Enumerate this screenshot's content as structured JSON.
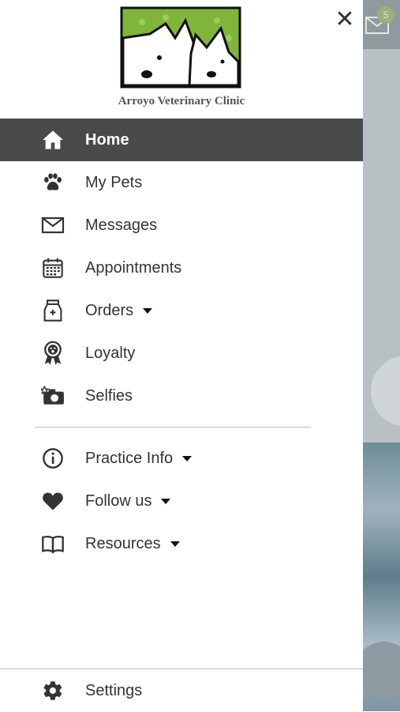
{
  "brand": {
    "name": "Arroyo Veterinary Clinic",
    "green": "#7fb53a"
  },
  "drawer": {
    "close_icon": "close-icon",
    "items": [
      {
        "label": "Home",
        "icon": "home-icon",
        "active": true
      },
      {
        "label": "My Pets",
        "icon": "paw-icon"
      },
      {
        "label": "Messages",
        "icon": "envelope-icon"
      },
      {
        "label": "Appointments",
        "icon": "calendar-icon"
      },
      {
        "label": "Orders",
        "icon": "food-bag-icon",
        "has_dropdown": true
      },
      {
        "label": "Loyalty",
        "icon": "award-ribbon-icon"
      },
      {
        "label": "Selfies",
        "icon": "camera-icon"
      }
    ],
    "secondary_items": [
      {
        "label": "Practice Info",
        "icon": "info-icon",
        "has_dropdown": true
      },
      {
        "label": "Follow us",
        "icon": "heart-icon",
        "has_dropdown": true
      },
      {
        "label": "Resources",
        "icon": "book-icon",
        "has_dropdown": true
      }
    ],
    "footer": {
      "label": "Settings",
      "icon": "gear-icon"
    }
  },
  "background": {
    "badge_count": "5"
  },
  "colors": {
    "active_bg": "#4a4a4a",
    "text": "#333333",
    "divider": "#bdbdbd"
  }
}
